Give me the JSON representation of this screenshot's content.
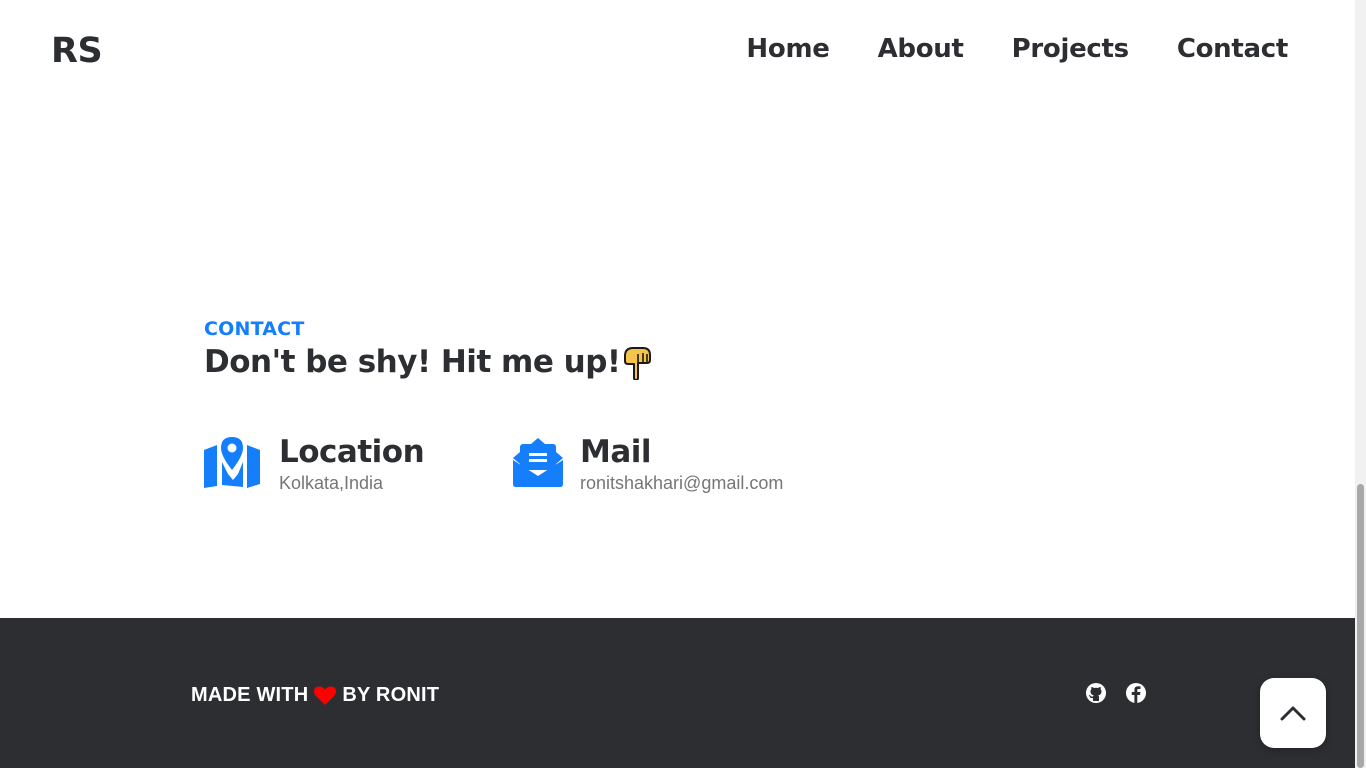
{
  "header": {
    "logo": "RS",
    "nav": [
      "Home",
      "About",
      "Projects",
      "Contact"
    ]
  },
  "contact": {
    "eyebrow": "CONTACT",
    "headline": "Don't be shy! Hit me up!",
    "headline_emoji": "pointing-down-hand-icon",
    "location": {
      "title": "Location",
      "value": "Kolkata,India",
      "icon": "map-icon"
    },
    "mail": {
      "title": "Mail",
      "value": "ronitshakhari@gmail.com",
      "icon": "mail-icon"
    }
  },
  "footer": {
    "made_prefix": "MADE WITH",
    "made_suffix": "BY RONIT",
    "social": [
      "github-icon",
      "facebook-icon"
    ]
  },
  "colors": {
    "accent": "#147efb",
    "text": "#2d2e32",
    "footer_bg": "#2d2e32",
    "muted": "#767676",
    "heart": "#ff0000"
  }
}
